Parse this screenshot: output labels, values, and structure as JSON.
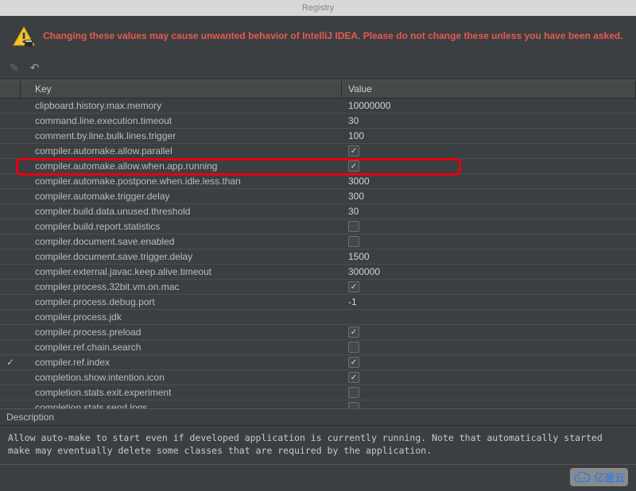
{
  "window": {
    "title": "Registry"
  },
  "banner": {
    "warning_text": "Changing these values may cause unwanted behavior of IntelliJ IDEA. Please do not change these unless you have been asked."
  },
  "columns": {
    "key": "Key",
    "value": "Value"
  },
  "rows": [
    {
      "key": "clipboard.history.max.memory",
      "value": "10000000",
      "type": "text"
    },
    {
      "key": "command.line.execution.timeout",
      "value": "30",
      "type": "text"
    },
    {
      "key": "comment.by.line.bulk.lines.trigger",
      "value": "100",
      "type": "text"
    },
    {
      "key": "compiler.automake.allow.parallel",
      "checked": true,
      "type": "check"
    },
    {
      "key": "compiler.automake.allow.when.app.running",
      "checked": true,
      "type": "check",
      "highlight": true
    },
    {
      "key": "compiler.automake.postpone.when.idle.less.than",
      "value": "3000",
      "type": "text"
    },
    {
      "key": "compiler.automake.trigger.delay",
      "value": "300",
      "type": "text"
    },
    {
      "key": "compiler.build.data.unused.threshold",
      "value": "30",
      "type": "text"
    },
    {
      "key": "compiler.build.report.statistics",
      "checked": false,
      "type": "check"
    },
    {
      "key": "compiler.document.save.enabled",
      "checked": false,
      "type": "check"
    },
    {
      "key": "compiler.document.save.trigger.delay",
      "value": "1500",
      "type": "text"
    },
    {
      "key": "compiler.external.javac.keep.alive.timeout",
      "value": "300000",
      "type": "text"
    },
    {
      "key": "compiler.process.32bit.vm.on.mac",
      "checked": true,
      "type": "check"
    },
    {
      "key": "compiler.process.debug.port",
      "value": "-1",
      "type": "text"
    },
    {
      "key": "compiler.process.jdk",
      "value": "",
      "type": "text"
    },
    {
      "key": "compiler.process.preload",
      "checked": true,
      "type": "check"
    },
    {
      "key": "compiler.ref.chain.search",
      "checked": false,
      "type": "check"
    },
    {
      "key": "compiler.ref.index",
      "checked": true,
      "type": "check",
      "required": true
    },
    {
      "key": "completion.show.intention.icon",
      "checked": true,
      "type": "check"
    },
    {
      "key": "completion.stats.exit.experiment",
      "checked": false,
      "type": "check"
    },
    {
      "key": "completion.stats.send.logs",
      "checked": false,
      "type": "check"
    }
  ],
  "description": {
    "label": "Description",
    "text": "Allow auto-make to start even if developed application is currently running. Note that automatically started make may eventually delete some classes that are required by the application."
  },
  "watermark": {
    "text": "亿速云"
  }
}
